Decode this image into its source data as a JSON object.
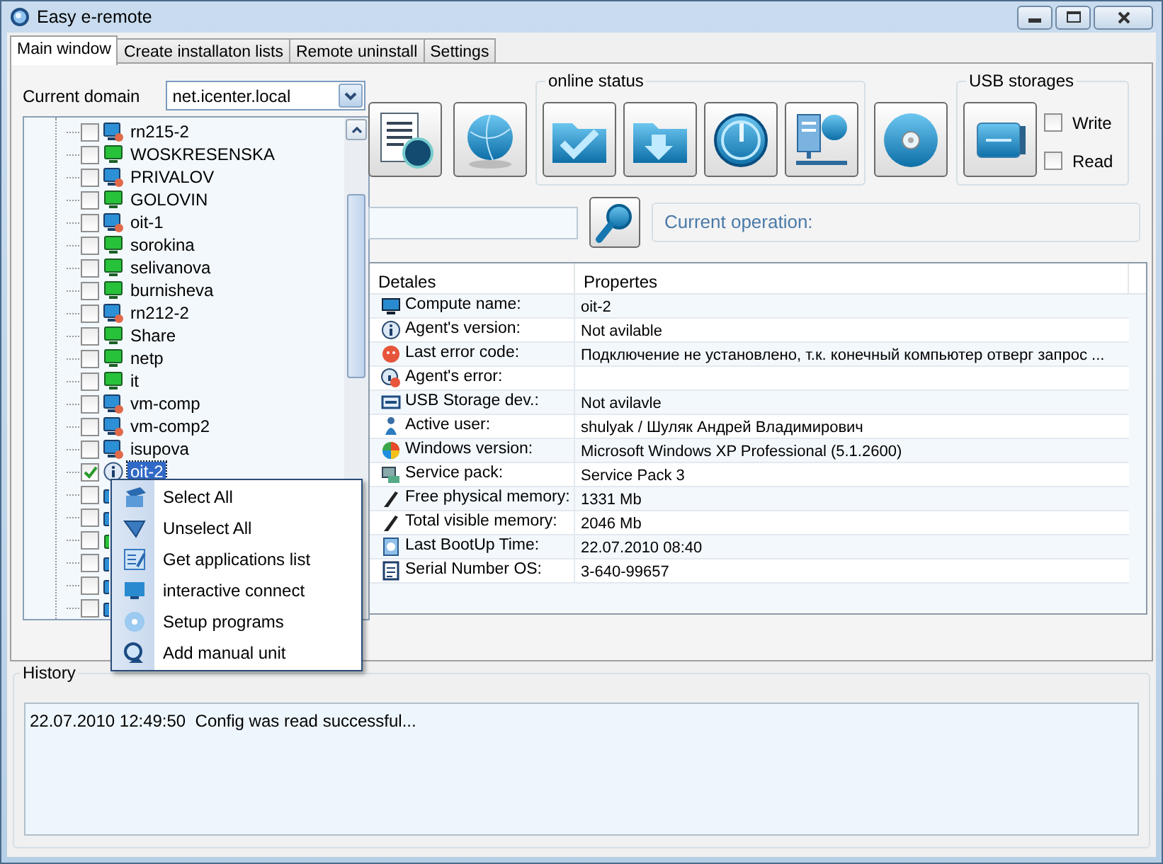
{
  "window": {
    "title": "Easy e-remote"
  },
  "tabs": [
    {
      "label": "Main window",
      "selected": true
    },
    {
      "label": "Create installaton lists",
      "selected": false
    },
    {
      "label": "Remote uninstall",
      "selected": false
    },
    {
      "label": "Settings",
      "selected": false
    }
  ],
  "domain": {
    "label": "Current domain",
    "value": "net.icenter.local"
  },
  "tree": [
    {
      "label": "rn215-2",
      "kind": "offline",
      "checked": false,
      "selected": false
    },
    {
      "label": "WOSKRESENSKA",
      "kind": "online",
      "checked": false,
      "selected": false
    },
    {
      "label": "PRIVALOV",
      "kind": "offline",
      "checked": false,
      "selected": false
    },
    {
      "label": "GOLOVIN",
      "kind": "online",
      "checked": false,
      "selected": false
    },
    {
      "label": "oit-1",
      "kind": "offline",
      "checked": false,
      "selected": false
    },
    {
      "label": "sorokina",
      "kind": "online",
      "checked": false,
      "selected": false
    },
    {
      "label": "selivanova",
      "kind": "online",
      "checked": false,
      "selected": false
    },
    {
      "label": "burnisheva",
      "kind": "online",
      "checked": false,
      "selected": false
    },
    {
      "label": "rn212-2",
      "kind": "offline",
      "checked": false,
      "selected": false
    },
    {
      "label": "Share",
      "kind": "online",
      "checked": false,
      "selected": false
    },
    {
      "label": "netp",
      "kind": "online",
      "checked": false,
      "selected": false
    },
    {
      "label": "it",
      "kind": "online",
      "checked": false,
      "selected": false
    },
    {
      "label": "vm-comp",
      "kind": "offline",
      "checked": false,
      "selected": false
    },
    {
      "label": "vm-comp2",
      "kind": "offline",
      "checked": false,
      "selected": false
    },
    {
      "label": "isupova",
      "kind": "offline",
      "checked": false,
      "selected": false
    },
    {
      "label": "oit-2",
      "kind": "info",
      "checked": true,
      "selected": true
    },
    {
      "kind": "offline",
      "checked": false,
      "selected": false
    },
    {
      "kind": "offline",
      "checked": false,
      "selected": false
    },
    {
      "kind": "online",
      "checked": false,
      "selected": false
    },
    {
      "kind": "offline",
      "checked": false,
      "selected": false
    },
    {
      "kind": "offline",
      "checked": false,
      "selected": false
    },
    {
      "kind": "offline",
      "checked": false,
      "selected": false
    }
  ],
  "online_status": {
    "title": "online status"
  },
  "usb_storages": {
    "title": "USB storages",
    "options": [
      {
        "label": "Write",
        "checked": false
      },
      {
        "label": "Read",
        "checked": false
      }
    ]
  },
  "current_operation": "Current operation:",
  "details": {
    "columns": [
      "Detales",
      "Propertes"
    ],
    "rows": [
      {
        "label": "Compute name:",
        "value": "oit-2"
      },
      {
        "label": "Agent's version:",
        "value": "Not avilable"
      },
      {
        "label": "Last error code:",
        "value": "Подключение не установлено, т.к. конечный компьютер отверг запрос ..."
      },
      {
        "label": "Agent's  error:",
        "value": ""
      },
      {
        "label": "USB Storage dev.:",
        "value": "Not avilavle"
      },
      {
        "label": "Active user:",
        "value": "shulyak / Шуляк Андрей Владимирович"
      },
      {
        "label": "Windows version:",
        "value": "Microsoft Windows XP Professional (5.1.2600)"
      },
      {
        "label": "Service pack:",
        "value": "Service Pack 3"
      },
      {
        "label": "Free physical memory:",
        "value": "1331 Mb"
      },
      {
        "label": "Total visible memory:",
        "value": "2046 Mb"
      },
      {
        "label": "Last BootUp Time:",
        "value": "22.07.2010 08:40"
      },
      {
        "label": "Serial Number OS:",
        "value": "3-640-99657"
      }
    ]
  },
  "context_menu": [
    {
      "label": "Select All"
    },
    {
      "label": "Unselect All"
    },
    {
      "label": "Get applications list"
    },
    {
      "label": "interactive connect"
    },
    {
      "label": "Setup programs"
    },
    {
      "label": "Add manual unit"
    }
  ],
  "history": {
    "title": "History",
    "entries": [
      "22.07.2010 12:49:50  Config was read successful..."
    ]
  }
}
